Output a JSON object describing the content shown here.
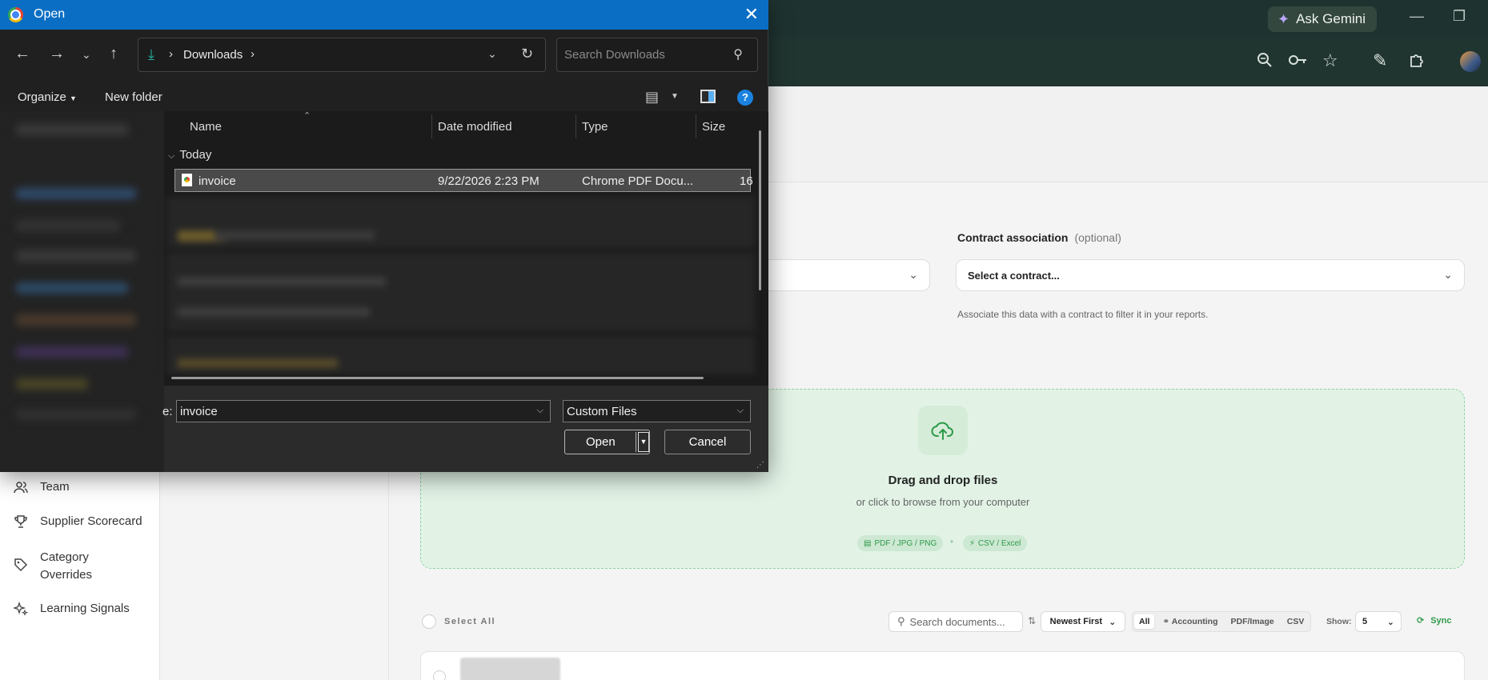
{
  "browser": {
    "ask_gemini": "Ask Gemini",
    "icons": [
      "sparkle-icon",
      "minimize-icon",
      "maximize-icon",
      "zoom-icon",
      "key-icon",
      "star-icon",
      "pen-icon",
      "extensions-icon",
      "profile-avatar"
    ]
  },
  "sidebar": {
    "items": [
      {
        "label": "Team",
        "icon": "users-icon"
      },
      {
        "label": "Supplier Scorecard",
        "icon": "trophy-icon"
      },
      {
        "label": "Category Overrides",
        "icon": "tag-icon"
      },
      {
        "label": "Learning Signals",
        "icon": "sparkles-icon"
      }
    ]
  },
  "form": {
    "contract_label": "Contract association",
    "contract_optional": "(optional)",
    "contract_value": "Select a contract...",
    "contract_hint": "Associate this data with a contract to filter it in your reports."
  },
  "dropzone": {
    "title": "Drag and drop files",
    "subtitle": "or click to browse from your computer",
    "chip_pdf": "PDF / JPG / PNG",
    "chip_csv": "CSV / Excel",
    "dot": "•"
  },
  "documents": {
    "select_all": "Select All",
    "search_placeholder": "Search documents...",
    "sort": "Newest First",
    "filters": [
      "All",
      "Accounting",
      "PDF/Image",
      "CSV"
    ],
    "show_label": "Show:",
    "show_value": "5",
    "sync": "Sync"
  },
  "dialog": {
    "title": "Open",
    "address_crumb": "Downloads",
    "search_placeholder": "Search Downloads",
    "organize": "Organize",
    "new_folder": "New folder",
    "help": "?",
    "columns": {
      "name": "Name",
      "date": "Date modified",
      "type": "Type",
      "size": "Size"
    },
    "group_today": "Today",
    "selected_file": {
      "name": "invoice",
      "date": "9/22/2026 2:23 PM",
      "type": "Chrome PDF Docu...",
      "size": "16"
    },
    "filename_label": "e:",
    "filename_value": "invoice",
    "filetype_value": "Custom Files",
    "open": "Open",
    "cancel": "Cancel"
  },
  "colors": {
    "title_bar": "#0a6ec4",
    "dialog_bg": "#202020",
    "accent_green": "#2e9a4a",
    "browser_chrome": "#213530"
  }
}
